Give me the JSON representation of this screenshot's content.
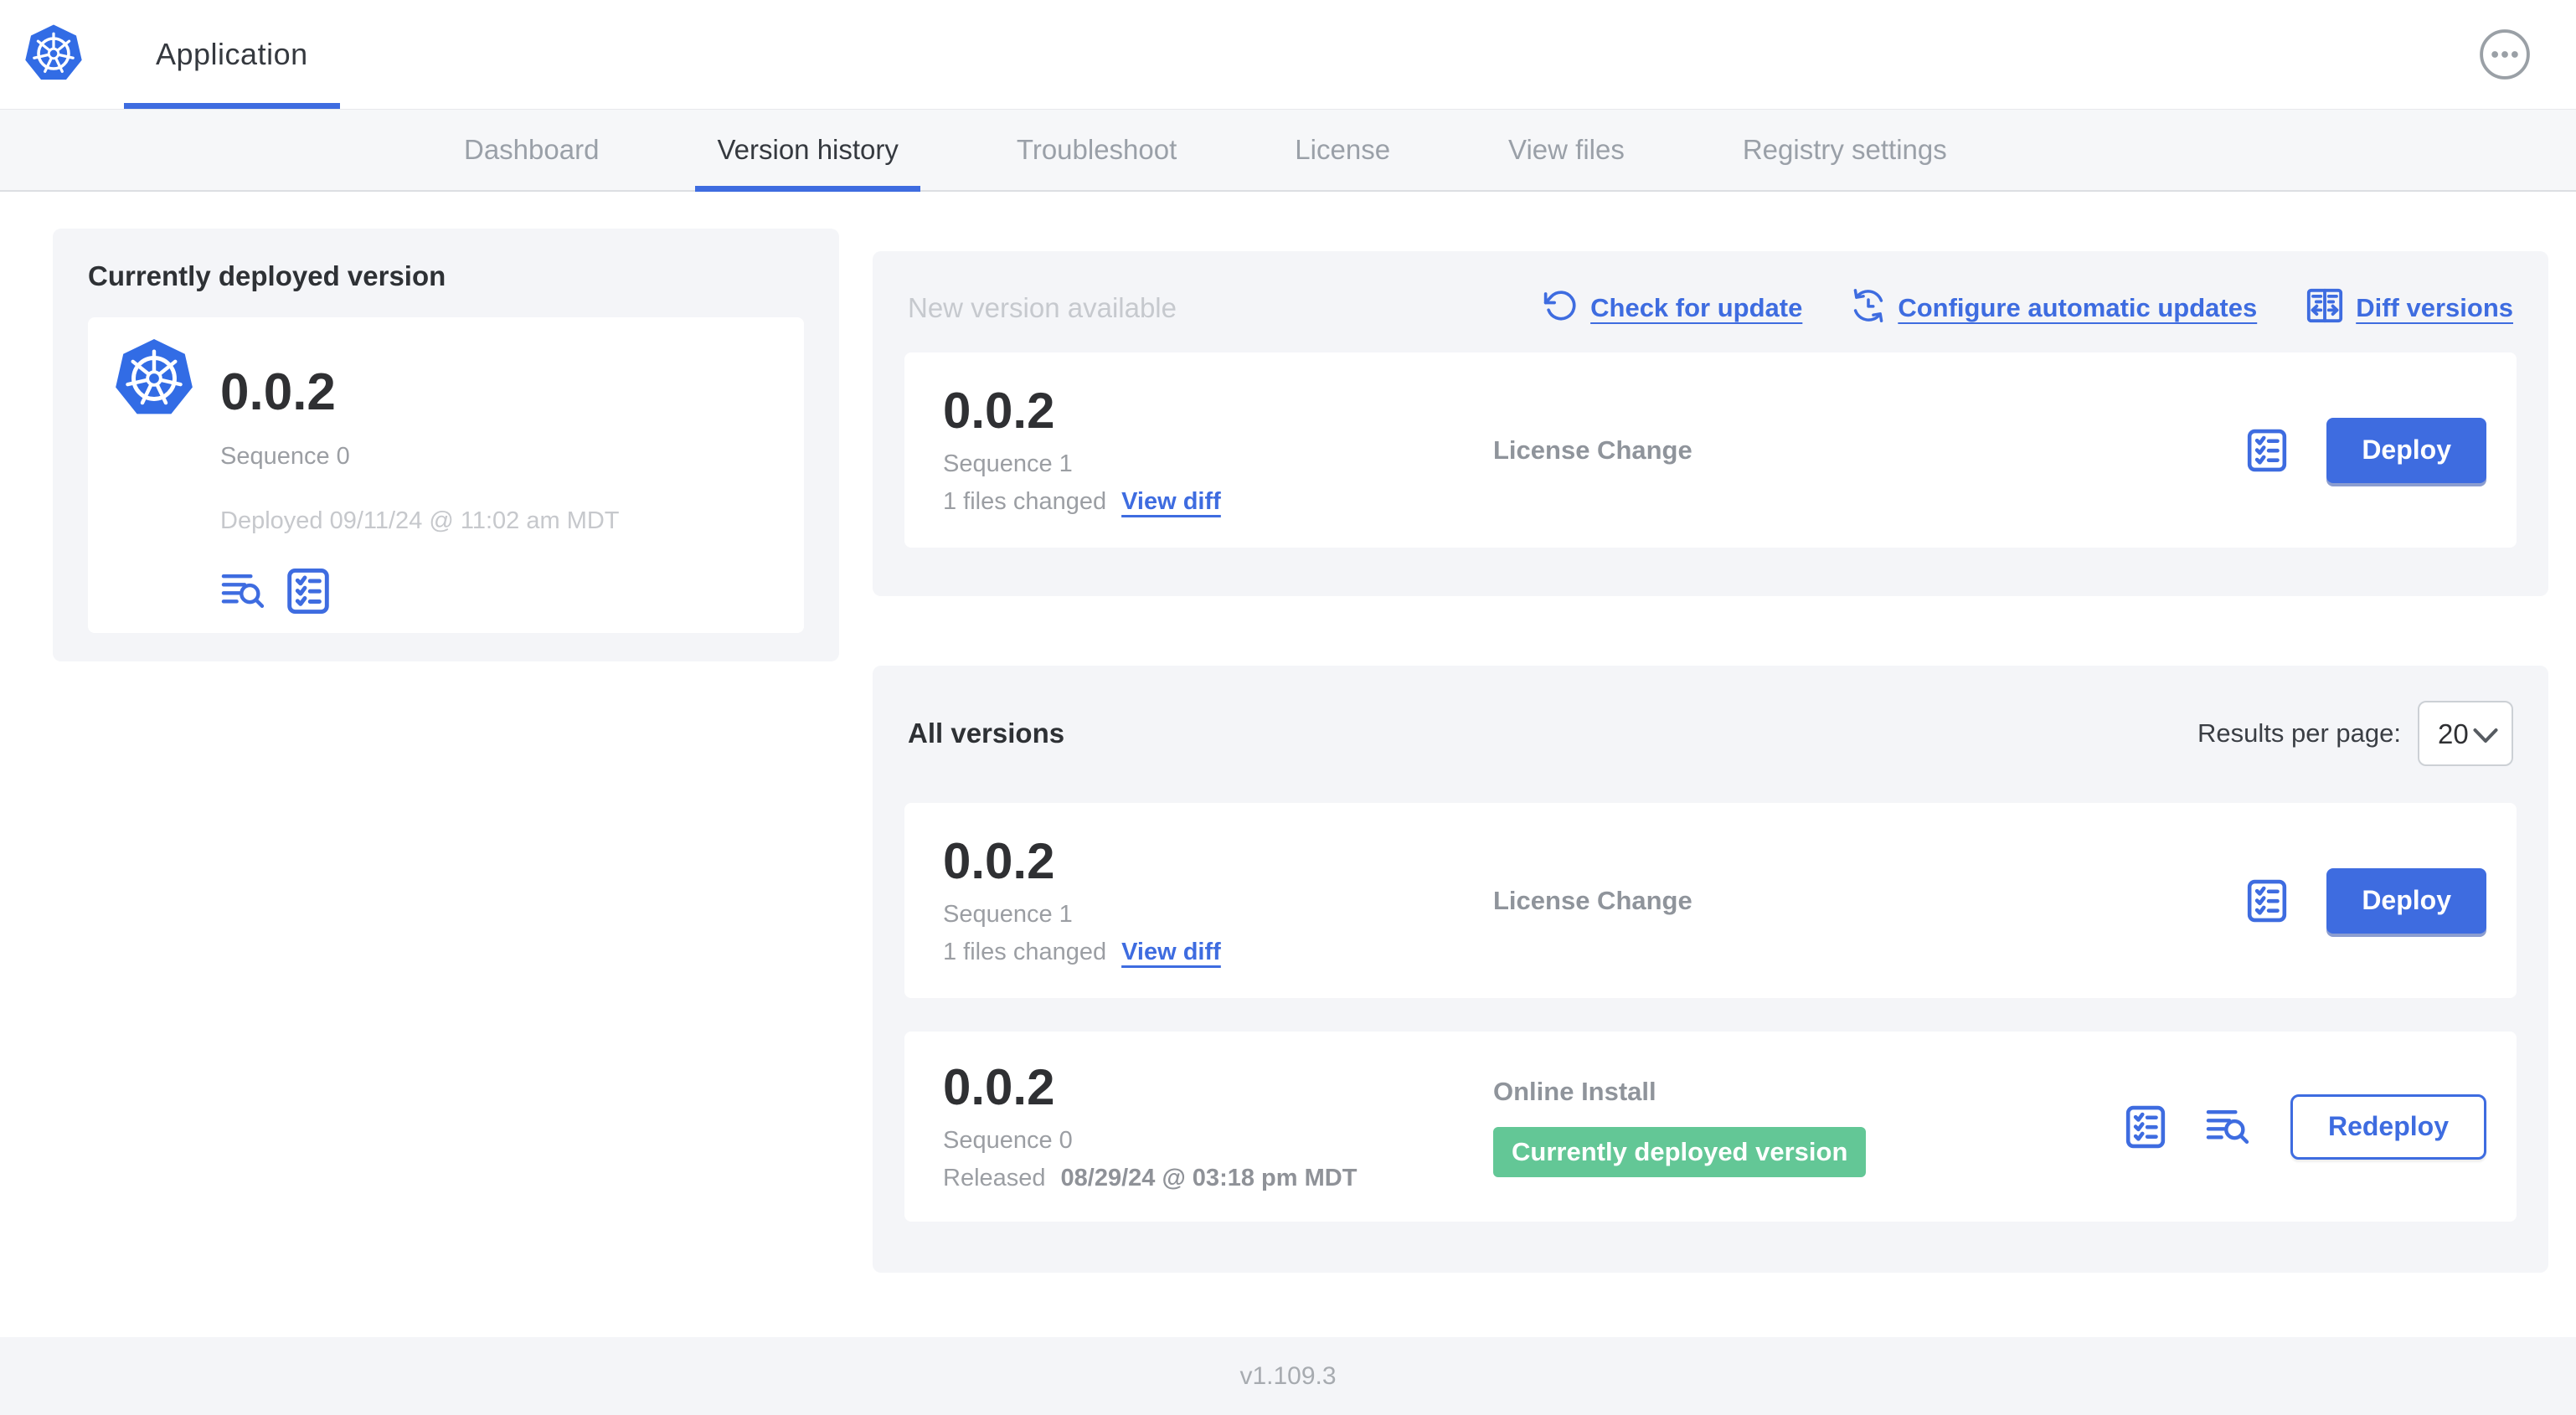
{
  "app": {
    "name": "Application",
    "footer_version": "v1.109.3"
  },
  "nav": {
    "active_tab": "Version history",
    "tabs": [
      {
        "label": "Dashboard"
      },
      {
        "label": "Version history"
      },
      {
        "label": "Troubleshoot"
      },
      {
        "label": "License"
      },
      {
        "label": "View files"
      },
      {
        "label": "Registry settings"
      }
    ]
  },
  "current_version_panel": {
    "title": "Currently deployed version",
    "version": "0.0.2",
    "sequence": "Sequence 0",
    "deployed_at": "Deployed 09/11/24 @ 11:02 am MDT",
    "icons": [
      "view-logs",
      "preflight-checks"
    ]
  },
  "new_version_panel": {
    "title": "New version available",
    "actions": {
      "check_for_update": "Check for update",
      "configure_updates": "Configure automatic updates",
      "diff_versions": "Diff versions"
    },
    "card": {
      "version": "0.0.2",
      "sequence": "Sequence 1",
      "files_changed": "1 files changed",
      "view_diff": "View diff",
      "source": "License Change",
      "deploy_button": "Deploy"
    }
  },
  "all_versions_panel": {
    "title": "All versions",
    "results_per_page_label": "Results per page:",
    "results_per_page_value": "20",
    "rows": [
      {
        "version": "0.0.2",
        "sequence": "Sequence 1",
        "files_changed": "1 files changed",
        "view_diff": "View diff",
        "source": "License Change",
        "action_button": "Deploy"
      },
      {
        "version": "0.0.2",
        "sequence": "Sequence 0",
        "released_label": "Released",
        "released_date": "08/29/24 @ 03:18 pm MDT",
        "source": "Online Install",
        "badge": "Currently deployed version",
        "action_button": "Redeploy"
      }
    ]
  },
  "colors": {
    "accent_blue": "#3e6ce0",
    "kubernetes_blue": "#326ce5",
    "badge_green": "#63c796"
  }
}
